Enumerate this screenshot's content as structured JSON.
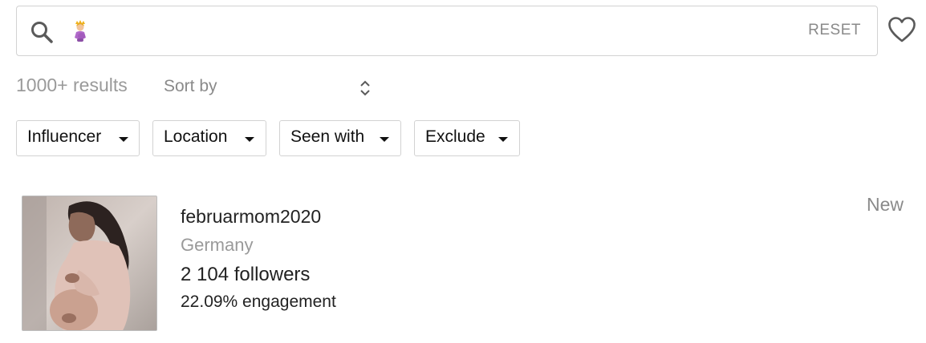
{
  "search": {
    "query_emoji": "pregnant-woman-emoji",
    "value": "",
    "placeholder": "",
    "reset_label": "RESET",
    "favorite_icon": "heart-outline-icon"
  },
  "results": {
    "count_label": "1000+ results",
    "sort_label": "Sort by"
  },
  "filters": [
    {
      "label": "Influencer"
    },
    {
      "label": "Location"
    },
    {
      "label": "Seen with"
    },
    {
      "label": "Exclude"
    }
  ],
  "items": [
    {
      "username": "februarmom2020",
      "location": "Germany",
      "followers": "2 104 followers",
      "engagement": "22.09% engagement",
      "badge": "New",
      "avatar": "profile-photo"
    }
  ],
  "colors": {
    "border": "#d2d2d2",
    "muted_text": "#8a8a8a",
    "text": "#222222"
  }
}
